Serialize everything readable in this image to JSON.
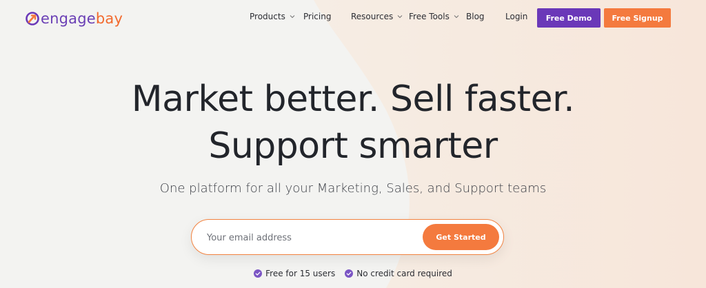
{
  "brand": {
    "name_part1": "engage",
    "name_part2": "bay",
    "purple": "#6a38b8",
    "orange": "#f47a3e"
  },
  "nav": {
    "items": [
      {
        "label": "Products",
        "has_dropdown": true
      },
      {
        "label": "Pricing",
        "has_dropdown": false
      },
      {
        "label": "Resources",
        "has_dropdown": true
      },
      {
        "label": "Free Tools",
        "has_dropdown": true
      },
      {
        "label": "Blog",
        "has_dropdown": false
      },
      {
        "label": "Login",
        "has_dropdown": false
      }
    ],
    "demo_label": "Free Demo",
    "signup_label": "Free Signup"
  },
  "hero": {
    "line1": "Market better. Sell faster.",
    "line2": "Support smarter",
    "subhead": "One platform for all your Marketing, Sales, and Support teams"
  },
  "signup_form": {
    "email_placeholder": "Your email address",
    "email_value": "",
    "button_label": "Get Started"
  },
  "perks": [
    {
      "label": "Free for 15 users",
      "icon": "check-circle-icon"
    },
    {
      "label": "No credit card required",
      "icon": "check-circle-icon"
    }
  ]
}
